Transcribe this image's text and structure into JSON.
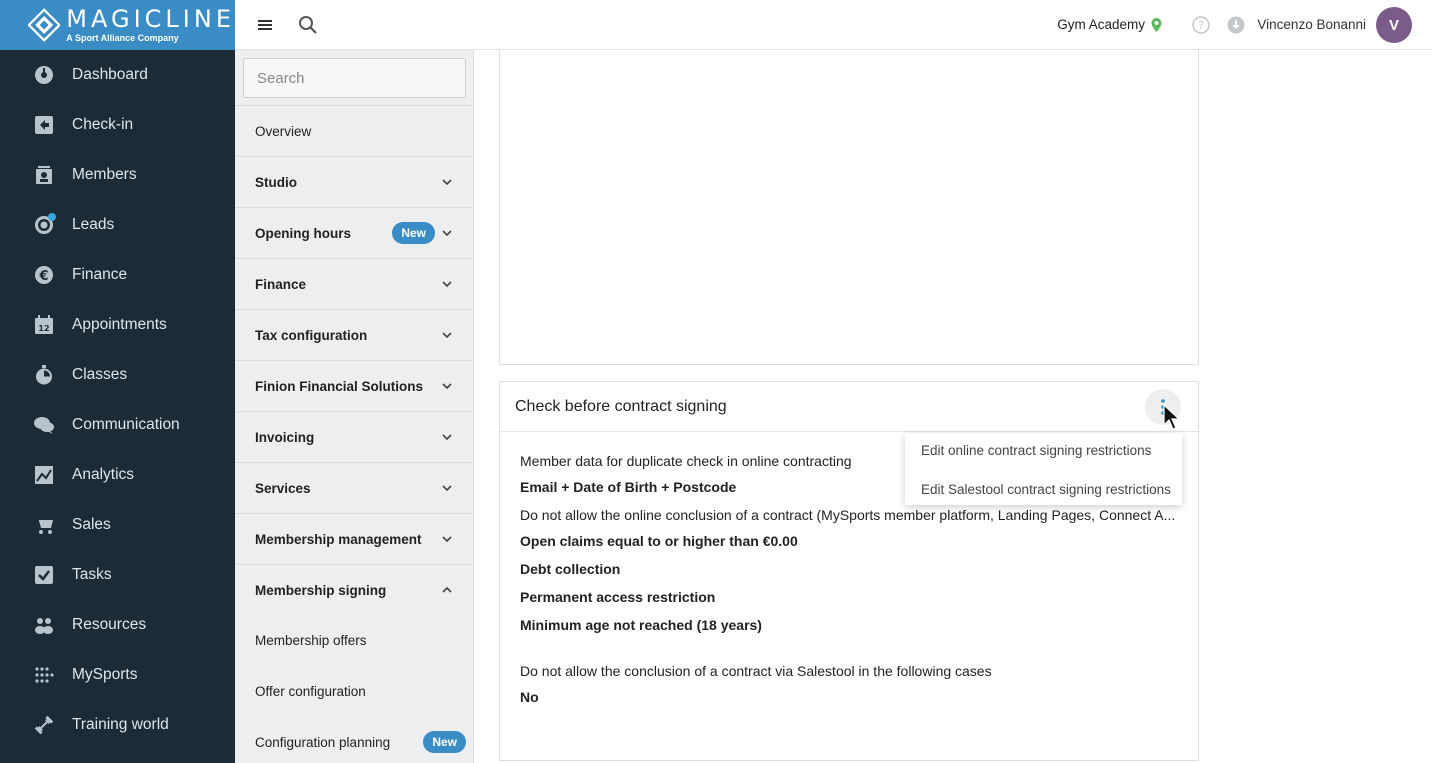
{
  "brand": {
    "name": "MAGICLINE",
    "tagline": "A Sport Alliance Company"
  },
  "nav": {
    "items": [
      {
        "label": "Dashboard",
        "icon": "dashboard-icon"
      },
      {
        "label": "Check-in",
        "icon": "check-in-icon"
      },
      {
        "label": "Members",
        "icon": "members-icon"
      },
      {
        "label": "Leads",
        "icon": "leads-icon"
      },
      {
        "label": "Finance",
        "icon": "euro-icon"
      },
      {
        "label": "Appointments",
        "icon": "calendar-icon"
      },
      {
        "label": "Classes",
        "icon": "stopwatch-icon"
      },
      {
        "label": "Communication",
        "icon": "chat-icon"
      },
      {
        "label": "Analytics",
        "icon": "chart-icon"
      },
      {
        "label": "Sales",
        "icon": "cart-icon"
      },
      {
        "label": "Tasks",
        "icon": "checkbox-icon"
      },
      {
        "label": "Resources",
        "icon": "people-icon"
      },
      {
        "label": "MySports",
        "icon": "grid-dots-icon"
      },
      {
        "label": "Training world",
        "icon": "dumbbell-icon"
      }
    ]
  },
  "topbar": {
    "studio": "Gym Academy",
    "user_name": "Vincenzo Bonanni",
    "avatar_initial": "V"
  },
  "settings": {
    "search_placeholder": "Search",
    "overview": "Overview",
    "sections": [
      {
        "label": "Studio"
      },
      {
        "label": "Opening hours",
        "badge": "New"
      },
      {
        "label": "Finance"
      },
      {
        "label": "Tax configuration"
      },
      {
        "label": "Finion Financial Solutions"
      },
      {
        "label": "Invoicing"
      },
      {
        "label": "Services"
      },
      {
        "label": "Membership management"
      },
      {
        "label": "Membership signing"
      }
    ],
    "subitems": [
      {
        "label": "Membership offers"
      },
      {
        "label": "Offer configuration"
      },
      {
        "label": "Configuration planning",
        "badge": "New"
      }
    ]
  },
  "card": {
    "title": "Check before contract signing",
    "rows": [
      "Member data for duplicate check in online contracting",
      "Email + Date of Birth + Postcode",
      "Do not allow the online conclusion of a contract (MySports member platform, Landing Pages, Connect A...",
      "Open claims equal to or higher than €0.00",
      "Debt collection",
      "Permanent access restriction",
      "Minimum age not reached (18 years)",
      "Do not allow the conclusion of a contract via Salestool in the following cases",
      "No"
    ]
  },
  "dropdown": {
    "items": [
      "Edit online contract signing restrictions",
      "Edit Salestool contract signing restrictions"
    ]
  },
  "colors": {
    "nav_bg": "#1c2b36",
    "brand_blue": "#3a8cc4",
    "badge": "#3a8cc4"
  }
}
